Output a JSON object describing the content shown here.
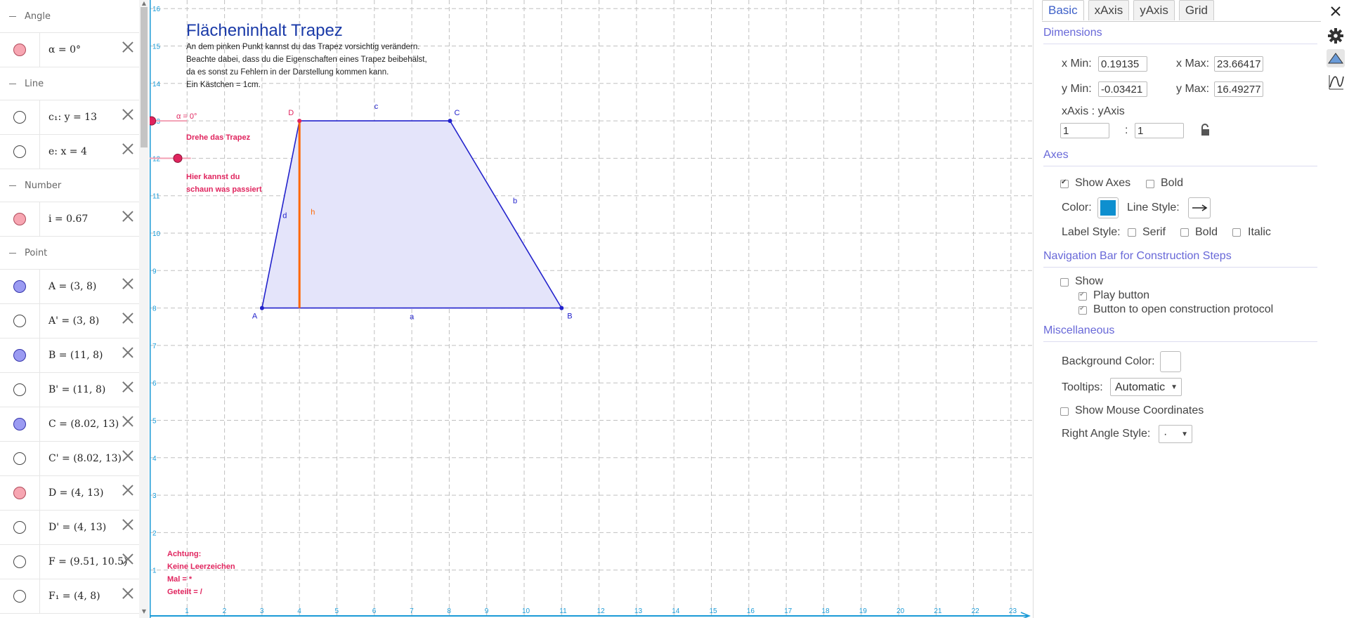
{
  "algebra": {
    "groups": [
      {
        "title": "Angle",
        "items": [
          {
            "label": "α = 0°",
            "marble": "pink"
          }
        ]
      },
      {
        "title": "Line",
        "items": [
          {
            "label": "c₁: y = 13",
            "marble": "empty"
          },
          {
            "label": "e: x = 4",
            "marble": "empty"
          }
        ]
      },
      {
        "title": "Number",
        "items": [
          {
            "label": "i = 0.67",
            "marble": "pink"
          }
        ]
      },
      {
        "title": "Point",
        "items": [
          {
            "label": "A = (3, 8)",
            "marble": "blue"
          },
          {
            "label": "A' = (3, 8)",
            "marble": "empty"
          },
          {
            "label": "B = (11, 8)",
            "marble": "blue"
          },
          {
            "label": "B' = (11, 8)",
            "marble": "empty"
          },
          {
            "label": "C = (8.02, 13)",
            "marble": "blue"
          },
          {
            "label": "C' = (8.02, 13)",
            "marble": "empty"
          },
          {
            "label": "D = (4, 13)",
            "marble": "pink"
          },
          {
            "label": "D' = (4, 13)",
            "marble": "empty"
          },
          {
            "label": "F = (9.51, 10.5)",
            "marble": "empty"
          },
          {
            "label": "F₁ = (4, 8)",
            "marble": "empty"
          }
        ]
      }
    ]
  },
  "graphics": {
    "title": "Flächeninhalt Trapez",
    "description": [
      "An dem pinken Punkt kannst du das Trapez vorsichtig verändern.",
      "Beachte dabei, dass du die Eigenschaften eines Trapez beibehälst,",
      "da es sonst zu Fehlern in der Darstellung kommen kann.",
      "Ein Kästchen = 1cm."
    ],
    "angle_label": "α = 0°",
    "rotate_hint": "Drehe das Trapez",
    "slider_hint": [
      "Hier kannst du",
      "schaun was passiert"
    ],
    "warning": [
      "Achtung:",
      "Keine Leerzeichen",
      "Mal = *",
      "Geteilt = /"
    ],
    "point_labels": {
      "A": "A",
      "B": "B",
      "C": "C",
      "D": "D"
    },
    "segment_labels": {
      "a": "a",
      "b": "b",
      "c": "c",
      "d": "d",
      "h": "h"
    },
    "x_ticks": [
      "1",
      "2",
      "3",
      "4",
      "5",
      "6",
      "7",
      "8",
      "9",
      "10",
      "11",
      "12",
      "13",
      "14",
      "15",
      "16",
      "17",
      "18",
      "19",
      "20",
      "21",
      "22",
      "23"
    ],
    "y_ticks": [
      "1",
      "2",
      "3",
      "4",
      "5",
      "6",
      "7",
      "8",
      "9",
      "10",
      "11",
      "12",
      "13",
      "14",
      "15",
      "16"
    ],
    "colors": {
      "axis": "#1a9ad6",
      "polygon_fill": "#e4e4fa",
      "polygon_stroke": "#2222cc",
      "height": "#ff6600",
      "pink": "#e0245e",
      "grid": "#c0c0c0"
    }
  },
  "properties": {
    "tabs": [
      "Basic",
      "xAxis",
      "yAxis",
      "Grid"
    ],
    "active_tab": "Basic",
    "dimensions": {
      "title": "Dimensions",
      "xmin_label": "x Min:",
      "xmin": "0.19135",
      "xmax_label": "x Max:",
      "xmax": "23.66417",
      "ymin_label": "y Min:",
      "ymin": "-0.03421",
      "ymax_label": "y Max:",
      "ymax": "16.49277",
      "ratio_label": "xAxis : yAxis",
      "ratio_x": "1",
      "ratio_sep": ":",
      "ratio_y": "1"
    },
    "axes": {
      "title": "Axes",
      "show_axes": "Show Axes",
      "show_axes_checked": true,
      "bold": "Bold",
      "color_label": "Color:",
      "color": "#0e8fcf",
      "line_style_label": "Line Style:",
      "label_style": "Label Style:",
      "serif": "Serif",
      "bold2": "Bold",
      "italic": "Italic"
    },
    "navbar": {
      "title": "Navigation Bar for Construction Steps",
      "show": "Show",
      "play": "Play button",
      "protocol": "Button to open construction protocol"
    },
    "misc": {
      "title": "Miscellaneous",
      "bg_label": "Background Color:",
      "tooltips_label": "Tooltips:",
      "tooltips_value": "Automatic",
      "mouse_coords": "Show Mouse Coordinates",
      "right_angle_label": "Right Angle Style:",
      "right_angle_value": "·"
    }
  },
  "side_icons": [
    "close-icon",
    "gear-icon",
    "graphics-icon",
    "algebra-curve-icon"
  ]
}
